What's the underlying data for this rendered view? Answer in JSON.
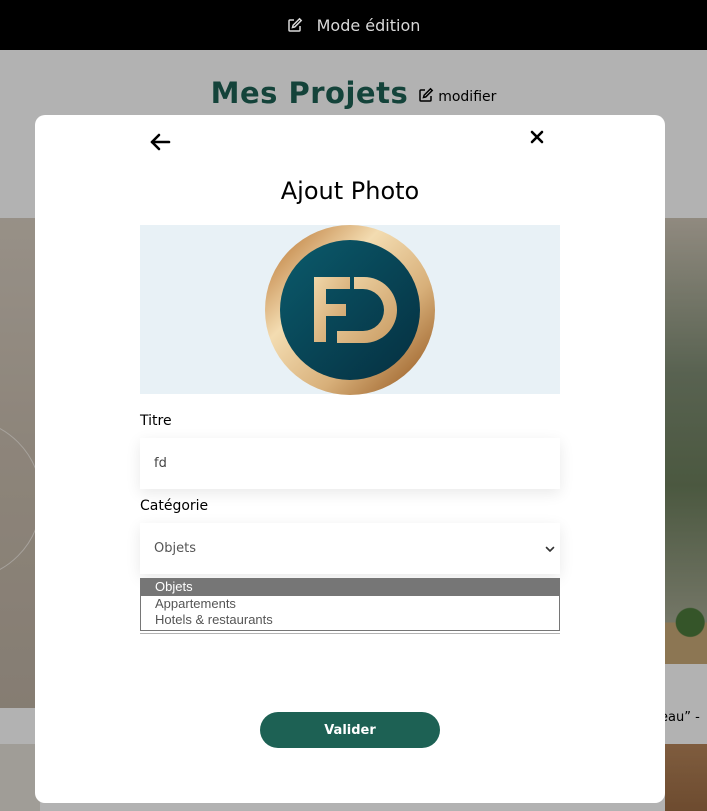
{
  "edit_bar": {
    "label": "Mode édition",
    "icon": "edit-icon"
  },
  "page": {
    "title": "Mes Projets",
    "modify_label": "modifier",
    "modify_icon": "edit-icon",
    "partial_caption": "eau” -"
  },
  "modal": {
    "back_icon": "arrow-left-icon",
    "close_icon": "close-icon",
    "title": "Ajout Photo",
    "photo_logo": "FD",
    "title_field": {
      "label": "Titre",
      "value": "fd"
    },
    "category_field": {
      "label": "Catégorie",
      "selected": "Objets",
      "options": [
        "Objets",
        "Appartements",
        "Hotels & restaurants"
      ]
    },
    "submit_label": "Valider"
  },
  "colors": {
    "brand_green": "#1D6154",
    "photo_bg": "#E8F1F6",
    "top_bar": "#000000",
    "option_highlight": "#767676"
  }
}
